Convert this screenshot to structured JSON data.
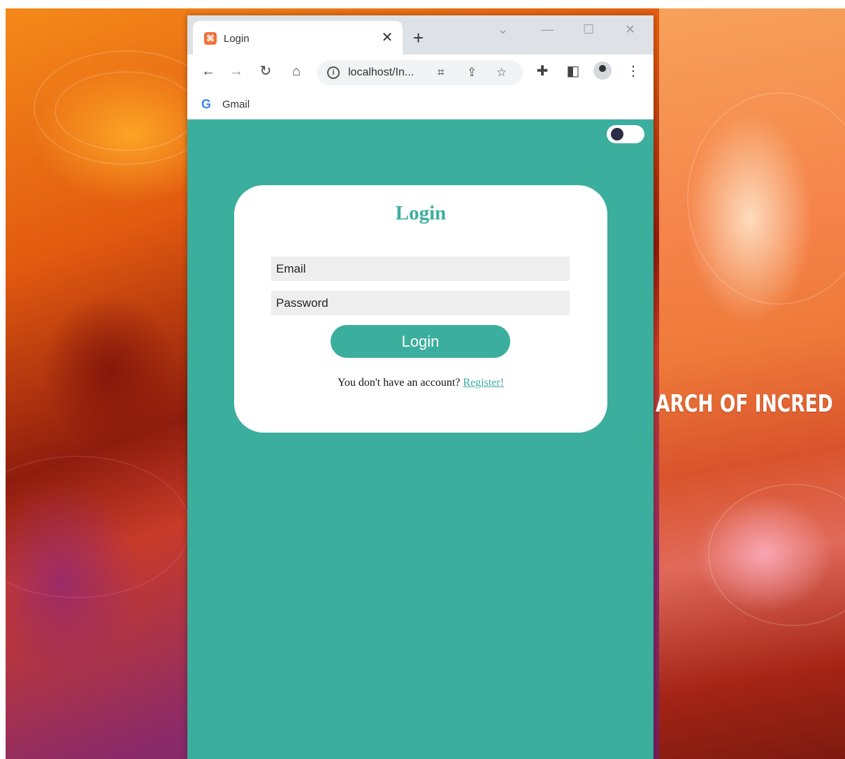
{
  "desktop": {
    "wallpaper_text": "ARCH OF INCRED"
  },
  "browser": {
    "tab": {
      "title": "Login",
      "favicon": "xampp-icon"
    },
    "address": {
      "url": "localhost/In..."
    },
    "bookmarks": [
      {
        "label": "Gmail",
        "icon": "google-icon"
      }
    ]
  },
  "page": {
    "theme_toggle": {
      "state": "off"
    },
    "login_card": {
      "title": "Login",
      "email_placeholder": "Email",
      "password_placeholder": "Password",
      "submit_label": "Login",
      "register_prompt": "You don't have an account?",
      "register_link": "Register!"
    }
  },
  "colors": {
    "accent": "#3cae9e",
    "card_bg": "#ffffff",
    "field_bg": "#eeeeee",
    "toggle_knob": "#2a2d45"
  }
}
